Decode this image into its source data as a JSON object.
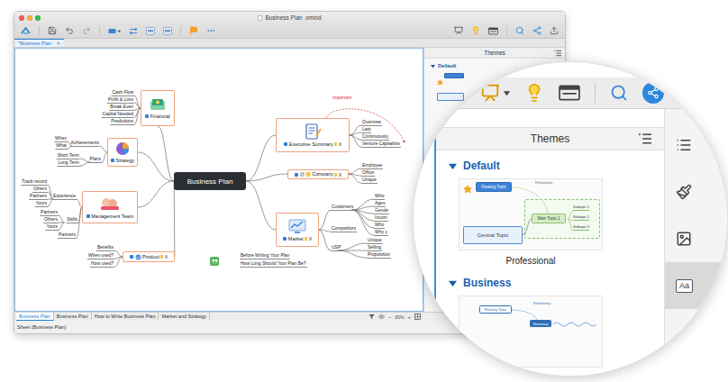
{
  "window": {
    "title": "Business Plan .xmind"
  },
  "editor_tabs": [
    {
      "label": "*Business Plan",
      "close": "×",
      "selected": true
    }
  ],
  "mindmap": {
    "central": "Business Plan",
    "topics": [
      {
        "label": "Financial",
        "kind": "card",
        "children": [
          {
            "label": "Cash Flow",
            "children": []
          },
          {
            "label": "Profit & Loss",
            "children": []
          },
          {
            "label": "Break Even",
            "children": []
          },
          {
            "label": "Capital Needed",
            "children": []
          },
          {
            "label": "Predictions",
            "children": []
          }
        ]
      },
      {
        "label": "Strategy",
        "kind": "card",
        "children": [
          {
            "label": "Achievements",
            "children": [
              "When",
              "What"
            ]
          },
          {
            "label": "Plans",
            "children": [
              "Short Term",
              "Long Term"
            ]
          }
        ]
      },
      {
        "label": "Management Team",
        "kind": "card",
        "children": [
          {
            "label": "Experience",
            "children": [
              "Track record",
              "Others",
              "Partners",
              "Yours"
            ]
          },
          {
            "label": "Skills",
            "children": [
              "Partners",
              "Others",
              "Yours"
            ]
          },
          {
            "label": "Partners",
            "children": []
          }
        ]
      },
      {
        "label": "Product",
        "kind": "bar",
        "children": [
          {
            "label": "Benefits",
            "children": []
          },
          {
            "label": "When used?",
            "children": []
          },
          {
            "label": "How used?",
            "children": []
          }
        ]
      },
      {
        "label": "Executive Summary",
        "kind": "card",
        "children": [
          {
            "label": "Overview",
            "children": []
          },
          {
            "label": "Last",
            "children": []
          },
          {
            "label": "Continuously",
            "children": []
          },
          {
            "label": "Venture Capitalists",
            "children": []
          }
        ]
      },
      {
        "label": "Company",
        "kind": "bar",
        "children": [
          {
            "label": "Employee",
            "children": []
          },
          {
            "label": "Office",
            "children": []
          },
          {
            "label": "Unique",
            "children": []
          }
        ]
      },
      {
        "label": "Market",
        "kind": "card",
        "children": [
          {
            "label": "Customers",
            "children": [
              "Who",
              "Ages",
              "Gende",
              "Incom",
              "Who",
              "Why c"
            ]
          },
          {
            "label": "Competitors",
            "children": []
          },
          {
            "label": "USP",
            "children": [
              "Unique",
              "Selling",
              "Proposition"
            ]
          }
        ]
      }
    ],
    "relationship": {
      "label": "Important"
    },
    "floating": [
      "Before Writing Your Plan",
      "How Long Should Your Plan Be?"
    ]
  },
  "panel": {
    "title": "Themes",
    "section": {
      "label": "Default",
      "expanded": true
    }
  },
  "sheets": [
    {
      "label": "Business Plan",
      "selected": true
    },
    {
      "label": "Business Plan",
      "selected": false
    },
    {
      "label": "How to Write Business Plan",
      "selected": false
    },
    {
      "label": "Market and Strategy",
      "selected": false
    }
  ],
  "zoom": {
    "minus": "−",
    "value": "80%",
    "plus": "+"
  },
  "status_bar": "Sheet (Business Plan)",
  "magnifier": {
    "panel_title": "Themes",
    "sections": [
      {
        "label": "Default",
        "expanded": true,
        "kind": "professional",
        "theme": "Professional",
        "preview": {
          "floating": "Floating Topic",
          "relationship": "Relationship",
          "main": "Main Topic 1",
          "subtopics": [
            "Subtopic 1",
            "Subtopic 2",
            "Subtopic 3"
          ],
          "central": "Central Topic"
        }
      },
      {
        "label": "Business",
        "expanded": true,
        "kind": "business",
        "preview": {
          "floating": "Floating Topic",
          "relationship": "Relationship",
          "summary": "Summary"
        }
      }
    ],
    "format_tab": {
      "label": "Aa",
      "selected": true
    }
  }
}
